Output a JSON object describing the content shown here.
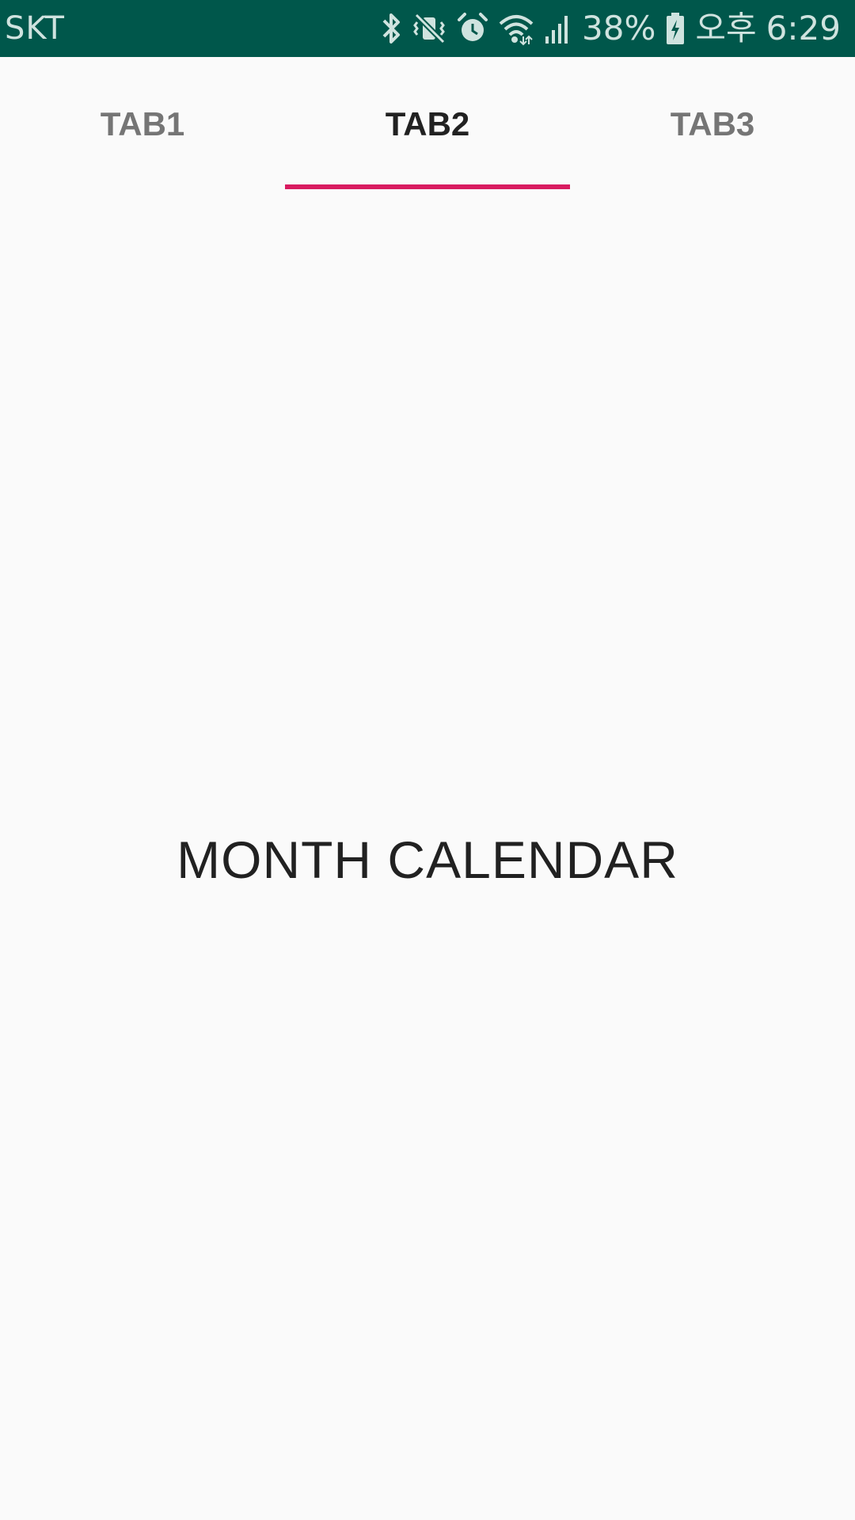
{
  "status_bar": {
    "carrier": "SKT",
    "battery_percent": "38%",
    "ampm": "오후",
    "time": "6:29",
    "background_color": "#00574b",
    "icons": [
      "bluetooth-icon",
      "vibrate-muted-icon",
      "alarm-icon",
      "wifi-icon",
      "signal-icon",
      "battery-charging-icon"
    ]
  },
  "tabs": [
    {
      "label": "TAB1",
      "selected": false
    },
    {
      "label": "TAB2",
      "selected": true
    },
    {
      "label": "TAB3",
      "selected": false
    }
  ],
  "tab_indicator_color": "#d81b60",
  "content": {
    "label": "MONTH CALENDAR"
  }
}
